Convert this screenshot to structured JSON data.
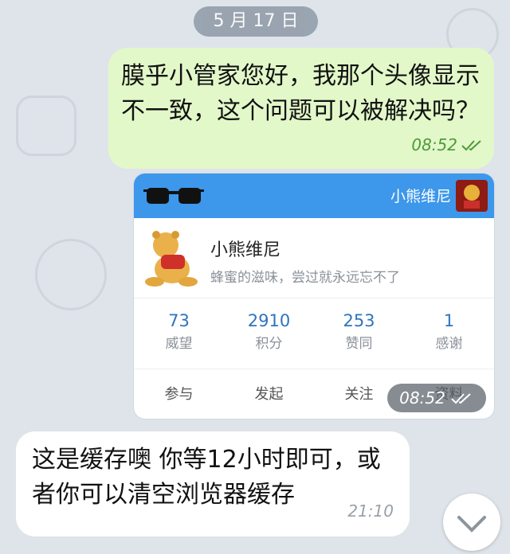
{
  "date_separator": "5 月 17 日",
  "messages": {
    "outgoing": {
      "text": "膜乎小管家您好，我那个头像显示不一致，这个问题可以被解决吗？",
      "time": "08:52",
      "status_icon": "double-check-icon"
    },
    "image_card": {
      "header_name": "小熊维尼",
      "profile_name": "小熊维尼",
      "bio": "蜂蜜的滋味，尝过就永远忘不了",
      "stats": [
        {
          "value": "73",
          "label": "威望"
        },
        {
          "value": "2910",
          "label": "积分"
        },
        {
          "value": "253",
          "label": "赞同"
        },
        {
          "value": "1",
          "label": "感谢"
        }
      ],
      "tabs": [
        "参与",
        "发起",
        "关注",
        "资料"
      ],
      "time": "08:52",
      "status_icon": "double-check-icon",
      "colors": {
        "header": "#3d97ea",
        "stat_value": "#2e74be"
      }
    },
    "incoming": {
      "text": "这是缓存噢 你等12小时即可，或者你可以清空浏览器缓存",
      "time": "21:10"
    }
  },
  "scroll_down_icon": "chevron-down-icon",
  "colors": {
    "outgoing_bubble": "#e2f8c9",
    "background": "#dfe4ea"
  }
}
